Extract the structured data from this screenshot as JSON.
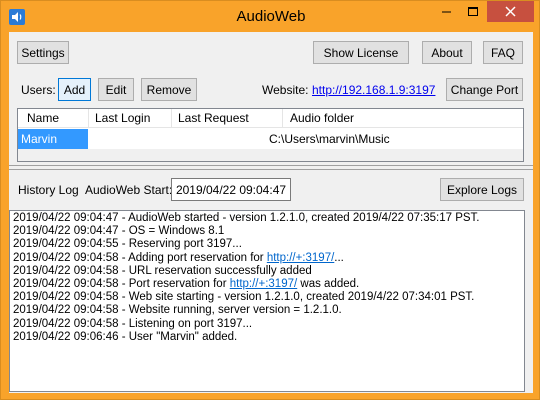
{
  "window": {
    "title": "AudioWeb",
    "accent_color": "#f9a32a",
    "icons": {
      "app": "speaker-icon",
      "minimize": "minimize-icon",
      "maximize": "maximize-icon",
      "close": "close-icon"
    }
  },
  "toolbar": {
    "settings_label": "Settings",
    "show_license_label": "Show License",
    "about_label": "About",
    "faq_label": "FAQ"
  },
  "users": {
    "label": "Users:",
    "add_label": "Add",
    "edit_label": "Edit",
    "remove_label": "Remove",
    "website_label": "Website:",
    "website_url": "http://192.168.1.9:3197",
    "change_port_label": "Change Port",
    "columns": [
      "Name",
      "Last Login",
      "Last Request",
      "Audio folder"
    ],
    "rows": [
      {
        "name": "Marvin",
        "last_login": "",
        "last_request": "",
        "audio_folder": "C:\\Users\\marvin\\Music"
      }
    ]
  },
  "history": {
    "label": "History Log",
    "start_label": "AudioWeb Start:",
    "start_value": "2019/04/22 09:04:47",
    "explore_logs_label": "Explore Logs",
    "lines": [
      {
        "text": "2019/04/22 09:04:47 - AudioWeb started - version 1.2.1.0, created 2019/4/22 07:35:17 PST."
      },
      {
        "text": "2019/04/22 09:04:47 - OS = Windows 8.1"
      },
      {
        "text": "2019/04/22 09:04:55 - Reserving port 3197..."
      },
      {
        "pre": "2019/04/22 09:04:58 - Adding port reservation for ",
        "link": "http://+:3197/",
        "post": "..."
      },
      {
        "text": "2019/04/22 09:04:58 - URL reservation successfully added"
      },
      {
        "pre": "2019/04/22 09:04:58 - Port reservation for ",
        "link": "http://+:3197/",
        "post": " was added."
      },
      {
        "text": "2019/04/22 09:04:58 - Web site starting - version 1.2.1.0, created 2019/4/22 07:34:01 PST."
      },
      {
        "text": "2019/04/22 09:04:58 - Website running, server version = 1.2.1.0."
      },
      {
        "text": "2019/04/22 09:04:58 - Listening on port 3197..."
      },
      {
        "text": "2019/04/22 09:06:46 - User \"Marvin\" added."
      }
    ]
  }
}
